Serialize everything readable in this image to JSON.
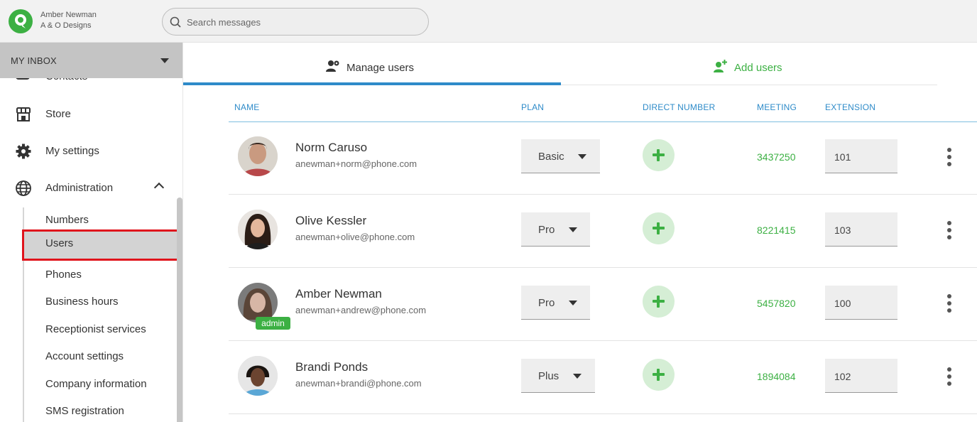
{
  "account": {
    "name": "Amber Newman",
    "org": "A & O Designs"
  },
  "search": {
    "placeholder": "Search messages"
  },
  "inbox": {
    "label": "MY INBOX"
  },
  "sidebar": {
    "partial_item": "Contacts",
    "items": [
      {
        "label": "Store",
        "icon": "store-icon"
      },
      {
        "label": "My settings",
        "icon": "gear-icon"
      },
      {
        "label": "Administration",
        "icon": "globe-icon"
      }
    ],
    "sub_items": [
      "Numbers",
      "Users",
      "Phones",
      "Business hours",
      "Receptionist services",
      "Account settings",
      "Company information",
      "SMS registration"
    ],
    "active_sub_item": "Users"
  },
  "tabs": [
    {
      "label": "Manage users",
      "icon": "manage-users-icon",
      "active": true
    },
    {
      "label": "Add users",
      "icon": "add-user-icon",
      "active": false
    }
  ],
  "table": {
    "headers": [
      "NAME",
      "PLAN",
      "DIRECT NUMBER",
      "MEETING",
      "EXTENSION"
    ],
    "rows": [
      {
        "name": "Norm Caruso",
        "email": "anewman+norm@phone.com",
        "plan": "Basic",
        "meeting": "3437250",
        "extension": "101",
        "badge": ""
      },
      {
        "name": "Olive Kessler",
        "email": "anewman+olive@phone.com",
        "plan": "Pro",
        "meeting": "8221415",
        "extension": "103",
        "badge": ""
      },
      {
        "name": "Amber Newman",
        "email": "anewman+andrew@phone.com",
        "plan": "Pro",
        "meeting": "5457820",
        "extension": "100",
        "badge": "admin"
      },
      {
        "name": "Brandi Ponds",
        "email": "anewman+brandi@phone.com",
        "plan": "Plus",
        "meeting": "1894084",
        "extension": "102",
        "badge": ""
      }
    ]
  },
  "colors": {
    "brand_green": "#3cb043",
    "accent_blue": "#2e8bc9",
    "highlight_red": "#e0141c"
  }
}
